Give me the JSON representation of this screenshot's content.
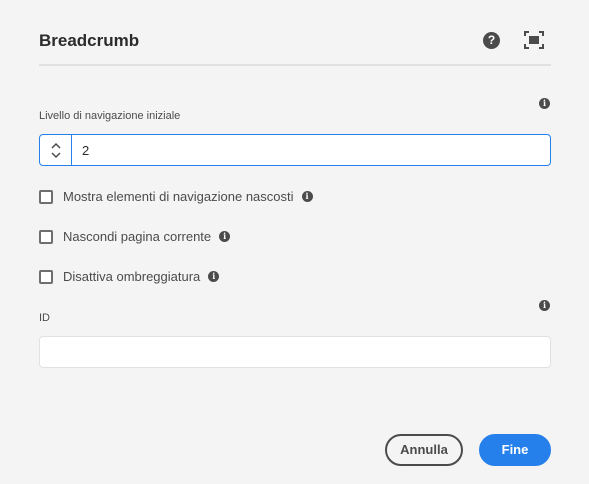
{
  "dialog": {
    "title": "Breadcrumb",
    "help_icon": "help-icon",
    "fullscreen_icon": "fullscreen-icon"
  },
  "fields": {
    "start_level": {
      "label": "Livello di navigazione iniziale",
      "value": "2"
    },
    "id": {
      "label": "ID",
      "value": ""
    }
  },
  "checkboxes": [
    {
      "label": "Mostra elementi di navigazione nascosti",
      "checked": false
    },
    {
      "label": "Nascondi pagina corrente",
      "checked": false
    },
    {
      "label": "Disattiva ombreggiatura",
      "checked": false
    }
  ],
  "footer": {
    "cancel_label": "Annulla",
    "done_label": "Fine"
  },
  "colors": {
    "accent": "#2680eb",
    "background": "#f4f4f4"
  }
}
